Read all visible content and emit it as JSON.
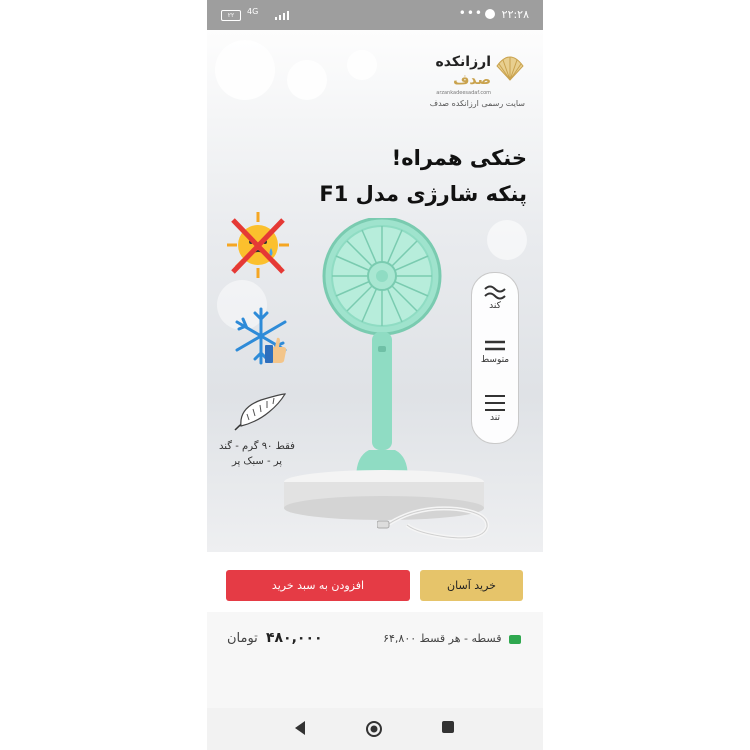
{
  "status_bar": {
    "time": "۲۲:۲۸",
    "battery": "۲۲",
    "network": "4G"
  },
  "brand": {
    "name_line1": "ارزانکده",
    "name_line2": "صدف",
    "url": "arzankadeesadaf.com",
    "tagline": "سایت رسمی ارزانکده صدف"
  },
  "headline": {
    "line1": "خنکی همراه!",
    "line2": "پنکه شارژی مدل F1"
  },
  "features": {
    "weight_text": "فقط ۹۰ گرم - گند پر - سبک پر"
  },
  "speeds": [
    {
      "label": "کند"
    },
    {
      "label": "متوسط"
    },
    {
      "label": "تند"
    }
  ],
  "buttons": {
    "easy_buy": "خرید آسان",
    "add_to_cart": "افزودن به سبد خرید"
  },
  "price": {
    "amount": "۴۸۰,۰۰۰",
    "currency": "تومان"
  },
  "installment": {
    "text": "قسطه - هر قسط ۶۴,۸۰۰"
  },
  "colors": {
    "fan": "#8fdcc3",
    "add_to_cart": "#e53b45",
    "easy_buy": "#e6c46a",
    "brand_gold": "#c9a24d"
  },
  "icons": [
    "shell-logo-icon",
    "no-heat-icon",
    "snowflake-icon",
    "feather-icon",
    "speed-slow-icon",
    "speed-medium-icon",
    "speed-fast-icon",
    "installment-icon",
    "back-icon",
    "home-icon",
    "recents-icon"
  ]
}
